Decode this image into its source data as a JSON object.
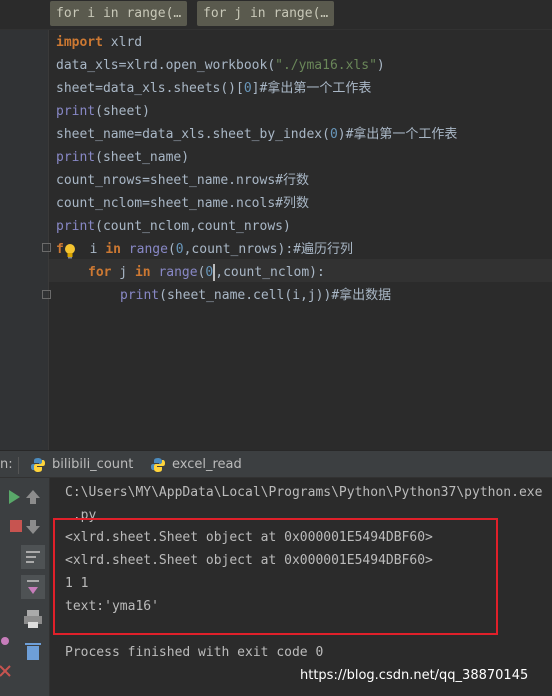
{
  "breadcrumbs": [
    "for i in range(…",
    "for j in range(…"
  ],
  "code": {
    "l1": {
      "kw": "import",
      "rest": " xlrd"
    },
    "l2": {
      "pre": "data_xls=xlrd.open_workbook(",
      "str": "\"./yma16.xls\"",
      "post": ")"
    },
    "l3": {
      "pre": "sheet=data_xls.sheets()[",
      "num": "0",
      "post": "]#拿出第一个工作表"
    },
    "l4": {
      "fn": "print",
      "rest": "(sheet)"
    },
    "l5": {
      "pre": "sheet_name=data_xls.sheet_by_index(",
      "num": "0",
      "post": ")#拿出第一个工作表"
    },
    "l6": {
      "fn": "print",
      "rest": "(sheet_name)"
    },
    "l7": {
      "text": "count_nrows=sheet_name.nrows#行数"
    },
    "l8": {
      "text": "count_nclom=sheet_name.ncols#列数"
    },
    "l9": {
      "fn": "print",
      "rest": "(count_nclom,count_nrows)"
    },
    "l10": {
      "kw1": "f",
      "mid": " i ",
      "kw2": "in",
      "fn": " range",
      "p1": "(",
      "num": "0",
      "p2": ",count_nrows):#遍历行列"
    },
    "l11": {
      "kw1": "for",
      "mid": " j ",
      "kw2": "in",
      "fn": " range",
      "p1": "(",
      "num": "0",
      "p2": ",count_nclom):"
    },
    "l12": {
      "fn": "print",
      "rest": "(sheet_name.cell(i,j))#拿出数据"
    }
  },
  "run": {
    "label": "n:",
    "tabs": [
      "bilibili_count",
      "excel_read"
    ]
  },
  "console": [
    "C:\\Users\\MY\\AppData\\Local\\Programs\\Python\\Python37\\python.exe",
    " .py",
    "<xlrd.sheet.Sheet object at 0x000001E5494DBF60>",
    "<xlrd.sheet.Sheet object at 0x000001E5494DBF60>",
    "1 1",
    "text:'yma16'",
    "Process finished with exit code 0"
  ],
  "watermark": "https://blog.csdn.net/qq_38870145",
  "colors": {
    "keyword": "#cc7832",
    "builtin": "#8888c6",
    "string": "#6a8759",
    "number": "#6897bb",
    "highlight": "#e0202a"
  }
}
